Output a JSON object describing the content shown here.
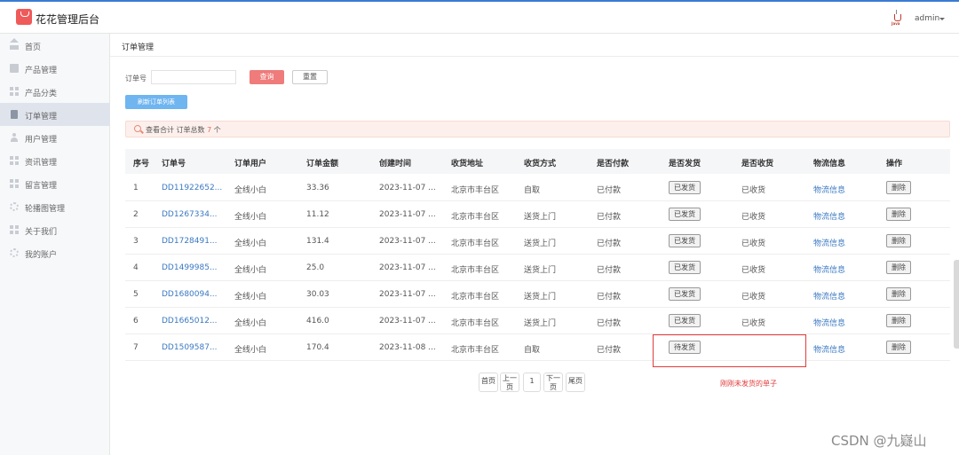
{
  "app": {
    "title": "花花管理后台"
  },
  "header": {
    "username": "admin",
    "avatar_icon": "java-cup-icon",
    "avatar_tag": "Java"
  },
  "sidebar": {
    "items": [
      {
        "label": "首页",
        "icon": "home-icon",
        "active": false
      },
      {
        "label": "产品管理",
        "icon": "product-icon",
        "active": false
      },
      {
        "label": "产品分类",
        "icon": "grid-icon",
        "active": false
      },
      {
        "label": "订单管理",
        "icon": "order-icon",
        "active": true
      },
      {
        "label": "用户管理",
        "icon": "user-icon",
        "active": false
      },
      {
        "label": "资讯管理",
        "icon": "grid-icon",
        "active": false
      },
      {
        "label": "留言管理",
        "icon": "grid-icon",
        "active": false
      },
      {
        "label": "轮播图管理",
        "icon": "gear-icon",
        "active": false
      },
      {
        "label": "关于我们",
        "icon": "grid-icon",
        "active": false
      },
      {
        "label": "我的账户",
        "icon": "gear-icon",
        "active": false
      }
    ]
  },
  "page": {
    "title": "订单管理"
  },
  "search": {
    "label": "订单号",
    "value": "",
    "placeholder": "",
    "query_button": "查询",
    "reset_button": "重置",
    "refresh_button": "刷新订单列表"
  },
  "summary": {
    "text": "查看合计  订单总数",
    "count": "7",
    "unit": "个"
  },
  "table": {
    "columns": [
      "序号",
      "订单号",
      "订单用户",
      "订单金额",
      "创建时间",
      "收货地址",
      "收货方式",
      "是否付款",
      "是否发货",
      "是否收货",
      "物流信息",
      "操作"
    ],
    "rows": [
      {
        "index": "1",
        "order_no": "DD11922652...",
        "user": "全线小白",
        "amount": "33.36",
        "created": "2023-11-07 ...",
        "address": "北京市丰台区",
        "delivery": "自取",
        "paid": "已付款",
        "shipped": "已发货",
        "received": "已收货",
        "logistics": "物流信息",
        "action": "删除"
      },
      {
        "index": "2",
        "order_no": "DD1267334...",
        "user": "全线小白",
        "amount": "11.12",
        "created": "2023-11-07 ...",
        "address": "北京市丰台区",
        "delivery": "送货上门",
        "paid": "已付款",
        "shipped": "已发货",
        "received": "已收货",
        "logistics": "物流信息",
        "action": "删除"
      },
      {
        "index": "3",
        "order_no": "DD1728491...",
        "user": "全线小白",
        "amount": "131.4",
        "created": "2023-11-07 ...",
        "address": "北京市丰台区",
        "delivery": "送货上门",
        "paid": "已付款",
        "shipped": "已发货",
        "received": "已收货",
        "logistics": "物流信息",
        "action": "删除"
      },
      {
        "index": "4",
        "order_no": "DD1499985...",
        "user": "全线小白",
        "amount": "25.0",
        "created": "2023-11-07 ...",
        "address": "北京市丰台区",
        "delivery": "送货上门",
        "paid": "已付款",
        "shipped": "已发货",
        "received": "已收货",
        "logistics": "物流信息",
        "action": "删除"
      },
      {
        "index": "5",
        "order_no": "DD1680094...",
        "user": "全线小白",
        "amount": "30.03",
        "created": "2023-11-07 ...",
        "address": "北京市丰台区",
        "delivery": "送货上门",
        "paid": "已付款",
        "shipped": "已发货",
        "received": "已收货",
        "logistics": "物流信息",
        "action": "删除"
      },
      {
        "index": "6",
        "order_no": "DD1665012...",
        "user": "全线小白",
        "amount": "416.0",
        "created": "2023-11-07 ...",
        "address": "北京市丰台区",
        "delivery": "送货上门",
        "paid": "已付款",
        "shipped": "已发货",
        "received": "已收货",
        "logistics": "物流信息",
        "action": "删除"
      },
      {
        "index": "7",
        "order_no": "DD1509587...",
        "user": "全线小白",
        "amount": "170.4",
        "created": "2023-11-08 ...",
        "address": "北京市丰台区",
        "delivery": "自取",
        "paid": "已付款",
        "shipped": "待发货",
        "received": "",
        "logistics": "物流信息",
        "action": "删除"
      }
    ]
  },
  "pagination": {
    "first": "首页",
    "prev_line1": "上一",
    "prev_line2": "页",
    "current": "1",
    "next_line1": "下一",
    "next_line2": "页",
    "last": "尾页"
  },
  "annotation": {
    "text": "刚刚未发货的单子",
    "color": "#e23b3b"
  },
  "watermark": {
    "text": "CSDN @九嶷山"
  },
  "colors": {
    "accent_red": "#ef7b7b",
    "link_blue": "#3a78c2",
    "refresh_blue": "#6fb5f0"
  }
}
